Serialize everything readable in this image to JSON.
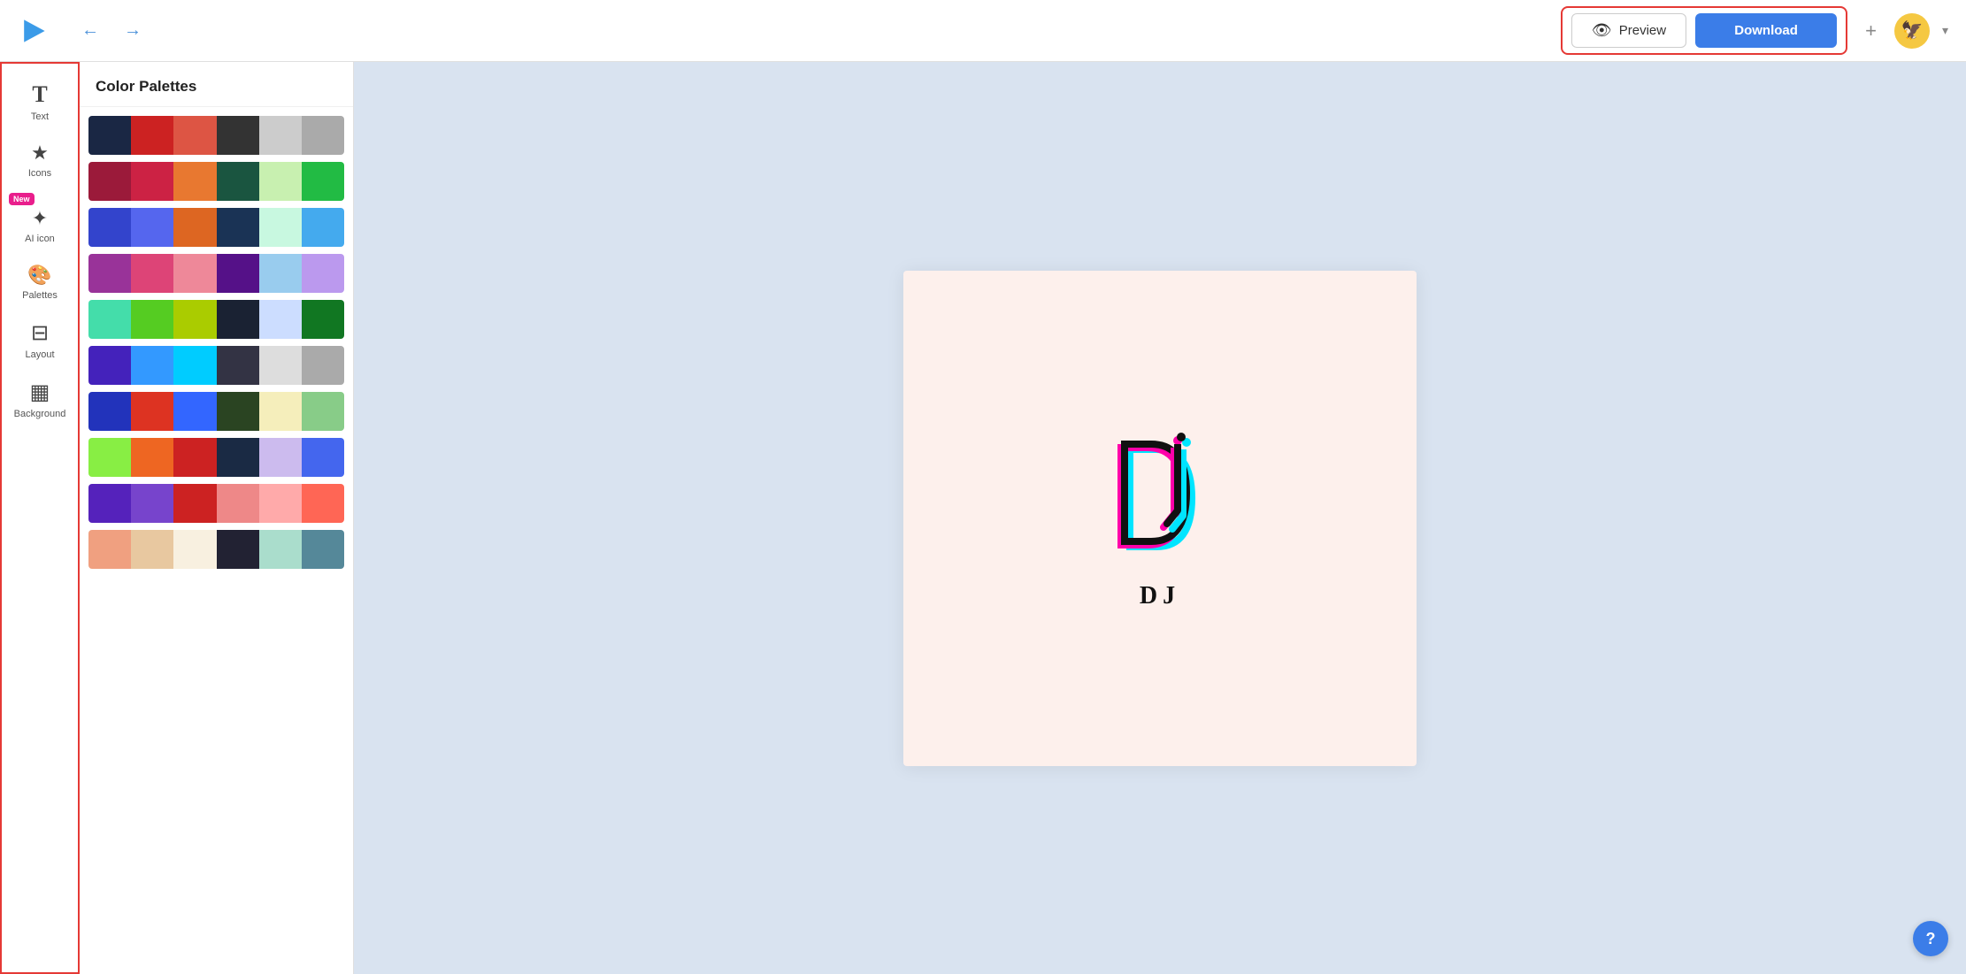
{
  "toolbar": {
    "preview_label": "Preview",
    "download_label": "Download",
    "plus_label": "+",
    "chevron": "▾"
  },
  "sidebar": {
    "items": [
      {
        "id": "text",
        "label": "Text",
        "icon": "T",
        "new": false
      },
      {
        "id": "icons",
        "label": "Icons",
        "icon": "★",
        "new": false
      },
      {
        "id": "ai-icon",
        "label": "AI icon",
        "icon": "✦",
        "new": true
      },
      {
        "id": "palettes",
        "label": "Palettes",
        "icon": "🎨",
        "new": false
      },
      {
        "id": "layout",
        "label": "Layout",
        "icon": "⊟",
        "new": false
      },
      {
        "id": "background",
        "label": "Background",
        "icon": "▦",
        "new": false
      }
    ]
  },
  "palettes_panel": {
    "title": "Color Palettes",
    "palettes": [
      [
        "#1a2744",
        "#cc2222",
        "#dd5544",
        "#333333",
        "#cccccc",
        "#aaaaaa"
      ],
      [
        "#9b1a3a",
        "#cc2244",
        "#e87830",
        "#1a5540",
        "#c8f0b0",
        "#22bb44"
      ],
      [
        "#3344cc",
        "#5566ee",
        "#dd6622",
        "#1a3355",
        "#c8f8e0",
        "#44aaee"
      ],
      [
        "#993399",
        "#dd4477",
        "#ee8899",
        "#551188",
        "#99ccee",
        "#bb99ee"
      ],
      [
        "#44ddaa",
        "#55cc22",
        "#aacc00",
        "#1a2233",
        "#ccddff",
        "#117722"
      ],
      [
        "#4422bb",
        "#3399ff",
        "#00ccff",
        "#333344",
        "#dddddd",
        "#aaaaaa"
      ],
      [
        "#2233bb",
        "#dd3322",
        "#3366ff",
        "#2a4422",
        "#f5eebb",
        "#88cc88"
      ],
      [
        "#88ee44",
        "#ee6622",
        "#cc2222",
        "#1a2a44",
        "#ccbbee",
        "#4466ee"
      ],
      [
        "#5522bb",
        "#7744cc",
        "#cc2222",
        "#ee8888",
        "#ffaaaa",
        "#ff6655"
      ],
      [
        "#f0a080",
        "#e8c8a0",
        "#f8f0e0",
        "#222233",
        "#aaddcc",
        "#558899"
      ]
    ]
  },
  "canvas": {
    "logo_text": "DJ",
    "background_color": "#fdf0ec"
  },
  "help": {
    "label": "?"
  }
}
